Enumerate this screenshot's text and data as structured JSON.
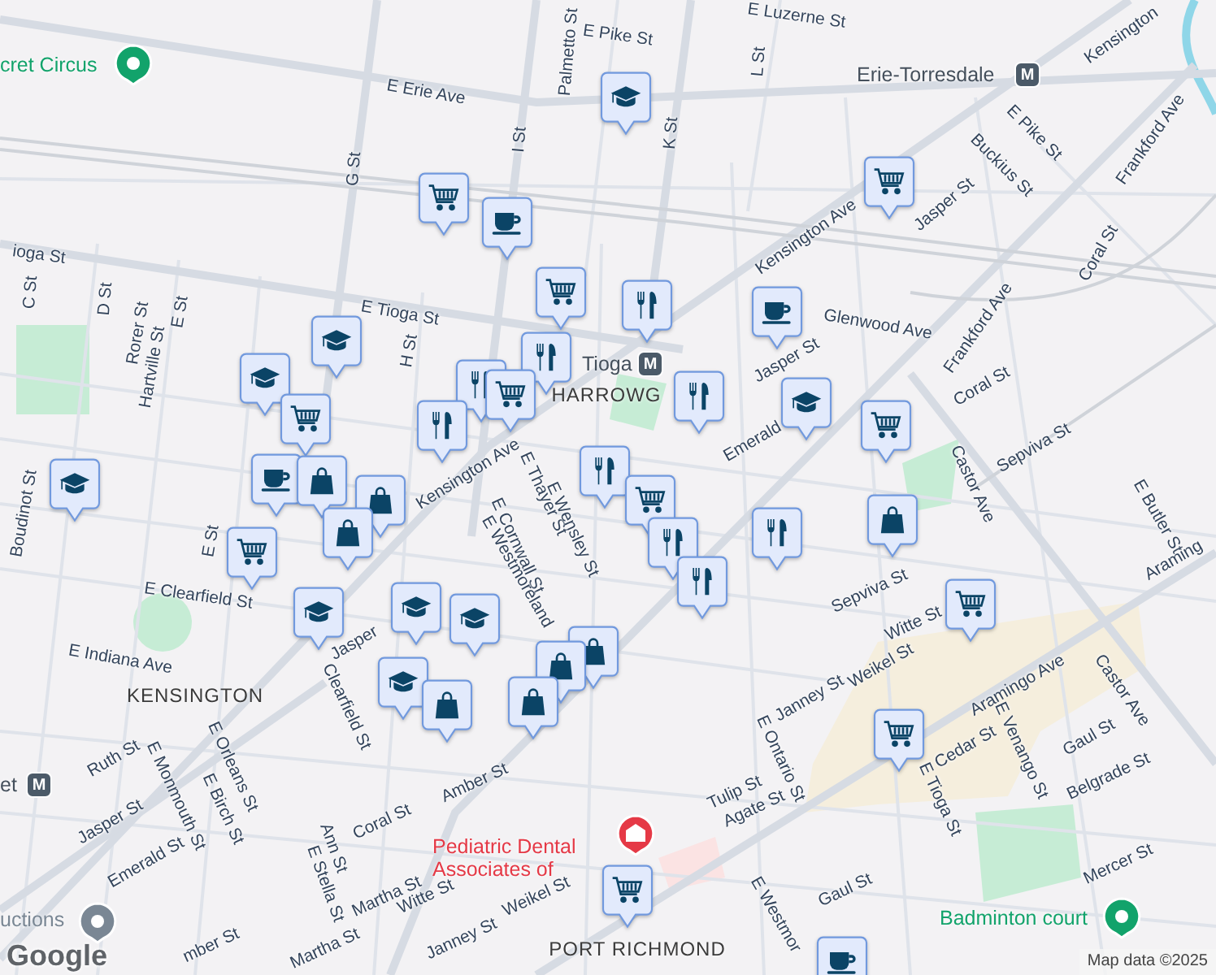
{
  "map": {
    "streets": [
      {
        "name": "E Luzerne St"
      },
      {
        "name": "E Pike St"
      },
      {
        "name": "Palmetto St"
      },
      {
        "name": "L St"
      },
      {
        "name": "K St"
      },
      {
        "name": "E Erie Ave"
      },
      {
        "name": "I St"
      },
      {
        "name": "G St"
      },
      {
        "name": "Kensington"
      },
      {
        "name": "E Pike St"
      },
      {
        "name": "Buckius St"
      },
      {
        "name": "Frankford Ave"
      },
      {
        "name": "Kensington Ave"
      },
      {
        "name": "Jasper St"
      },
      {
        "name": "Coral St"
      },
      {
        "name": "ioga St"
      },
      {
        "name": "C St"
      },
      {
        "name": "D St"
      },
      {
        "name": "Rorer St"
      },
      {
        "name": "Hartville St"
      },
      {
        "name": "E St"
      },
      {
        "name": "E Tioga St"
      },
      {
        "name": "H St"
      },
      {
        "name": "Glenwood Ave"
      },
      {
        "name": "Frankford Ave"
      },
      {
        "name": "Jasper St"
      },
      {
        "name": "Coral St"
      },
      {
        "name": "Emerald"
      },
      {
        "name": "Castor Ave"
      },
      {
        "name": "Sepviva St"
      },
      {
        "name": "E Butler St"
      },
      {
        "name": "Araming"
      },
      {
        "name": "Boudinot St"
      },
      {
        "name": "E St"
      },
      {
        "name": "E Clearfield St"
      },
      {
        "name": "E Indiana Ave"
      },
      {
        "name": "Kensington Ave"
      },
      {
        "name": "E Thayer St"
      },
      {
        "name": "E Wensley St"
      },
      {
        "name": "E Cornwall St"
      },
      {
        "name": "E Westmoreland"
      },
      {
        "name": "Jasper"
      },
      {
        "name": "Clearfield St"
      },
      {
        "name": "Ruth St"
      },
      {
        "name": "E Monmouth St"
      },
      {
        "name": "E Orleans St"
      },
      {
        "name": "E Birch St"
      },
      {
        "name": "Jasper St"
      },
      {
        "name": "Emerald St"
      },
      {
        "name": "Coral St"
      },
      {
        "name": "Amber St"
      },
      {
        "name": "Ann St"
      },
      {
        "name": "E Stella St"
      },
      {
        "name": "Martha St"
      },
      {
        "name": "Witte St"
      },
      {
        "name": "Janney St"
      },
      {
        "name": "Weikel St"
      },
      {
        "name": "Martha St"
      },
      {
        "name": "mber St"
      },
      {
        "name": "Sepviva St"
      },
      {
        "name": "Witte St"
      },
      {
        "name": "Janney St"
      },
      {
        "name": "Weikel St"
      },
      {
        "name": "Aramingo Ave"
      },
      {
        "name": "Castor Ave"
      },
      {
        "name": "Gaul St"
      },
      {
        "name": "Cedar St"
      },
      {
        "name": "E Venango St"
      },
      {
        "name": "Belgrade St"
      },
      {
        "name": "E Tioga St"
      },
      {
        "name": "E Ontario St"
      },
      {
        "name": "Tulip St"
      },
      {
        "name": "Agate St"
      },
      {
        "name": "Mercer St"
      },
      {
        "name": "Gaul St"
      },
      {
        "name": "E Westmor"
      }
    ],
    "areas": [
      {
        "name": "KENSINGTON"
      },
      {
        "name": "HARROWG"
      },
      {
        "name": "PORT RICHMOND"
      }
    ],
    "places": [
      {
        "name": "cret Circus",
        "kind": "park"
      },
      {
        "name": "Erie-Torresdale",
        "kind": "transit",
        "badge": "M"
      },
      {
        "name": "Tioga",
        "kind": "transit",
        "badge": "M"
      },
      {
        "name": "et",
        "kind": "transit",
        "badge": "M"
      },
      {
        "name": "uctions",
        "kind": "generic"
      },
      {
        "name": "Pediatric Dental Associates of",
        "kind": "medical"
      },
      {
        "name": "Badminton court",
        "kind": "park"
      }
    ],
    "pins": [
      {
        "kind": "cap"
      },
      {
        "kind": "cart"
      },
      {
        "kind": "cup"
      },
      {
        "kind": "cart"
      },
      {
        "kind": "cart"
      },
      {
        "kind": "fork"
      },
      {
        "kind": "cup"
      },
      {
        "kind": "cap"
      },
      {
        "kind": "cap"
      },
      {
        "kind": "cart"
      },
      {
        "kind": "fork"
      },
      {
        "kind": "fork"
      },
      {
        "kind": "cart"
      },
      {
        "kind": "fork"
      },
      {
        "kind": "fork"
      },
      {
        "kind": "cap"
      },
      {
        "kind": "cart"
      },
      {
        "kind": "cap"
      },
      {
        "kind": "cup"
      },
      {
        "kind": "bag"
      },
      {
        "kind": "bag"
      },
      {
        "kind": "bag"
      },
      {
        "kind": "cart"
      },
      {
        "kind": "fork"
      },
      {
        "kind": "cart"
      },
      {
        "kind": "fork"
      },
      {
        "kind": "fork"
      },
      {
        "kind": "fork"
      },
      {
        "kind": "bag"
      },
      {
        "kind": "cart"
      },
      {
        "kind": "cap"
      },
      {
        "kind": "cap"
      },
      {
        "kind": "cap"
      },
      {
        "kind": "bag"
      },
      {
        "kind": "bag"
      },
      {
        "kind": "cap"
      },
      {
        "kind": "bag"
      },
      {
        "kind": "bag"
      },
      {
        "kind": "cart"
      },
      {
        "kind": "cart"
      },
      {
        "kind": "cup"
      }
    ],
    "logo": "Google",
    "attribution": "Map data ©2025"
  }
}
